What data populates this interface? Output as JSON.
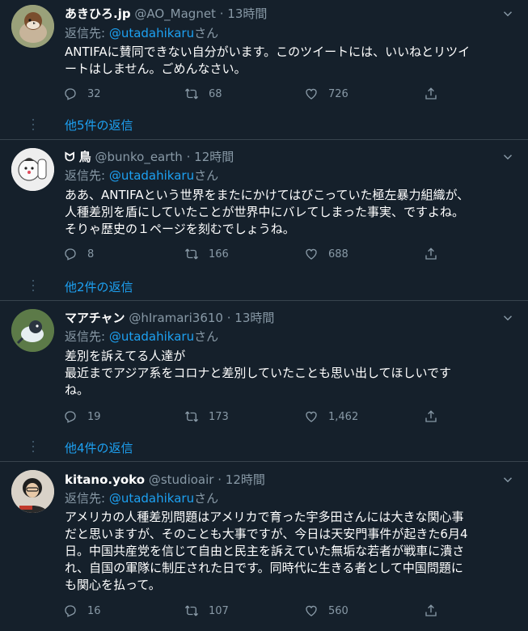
{
  "tweets": [
    {
      "name": "あきひろ.jp",
      "handle": "@AO_Magnet",
      "sep": "·",
      "time": "13時間",
      "reply_prefix": "返信先: ",
      "reply_to": "@utadahikaru",
      "reply_suffix": "さん",
      "text": "ANTIFAに賛同できない自分がいます。このツイートには、いいねとリツイ\nートはしません。ごめんなさい。",
      "replies": "32",
      "retweets": "68",
      "likes": "726",
      "more_replies": "他5件の返信"
    },
    {
      "name": "ᗢ 鳥",
      "handle": "@bunko_earth",
      "sep": "·",
      "time": "12時間",
      "reply_prefix": "返信先: ",
      "reply_to": "@utadahikaru",
      "reply_suffix": "さん",
      "text": "ああ、ANTIFAという世界をまたにかけてはびこっていた極左暴力組織が、\n人種差別を盾にしていたことが世界中にバレてしまった事実、ですよね。\nそりゃ歴史の１ページを刻むでしょうね。",
      "replies": "8",
      "retweets": "166",
      "likes": "688",
      "more_replies": "他2件の返信"
    },
    {
      "name": "マアチャン",
      "handle": "@hIramari3610",
      "sep": "·",
      "time": "13時間",
      "reply_prefix": "返信先: ",
      "reply_to": "@utadahikaru",
      "reply_suffix": "さん",
      "text": "差別を訴えてる人達が\n最近までアジア系をコロナと差別していたことも思い出してほしいです\nね。",
      "replies": "19",
      "retweets": "173",
      "likes": "1,462",
      "more_replies": "他4件の返信"
    },
    {
      "name": "kitano.yoko",
      "handle": "@studioair",
      "sep": "·",
      "time": "12時間",
      "reply_prefix": "返信先: ",
      "reply_to": "@utadahikaru",
      "reply_suffix": "さん",
      "text": "アメリカの人種差別問題はアメリカで育った宇多田さんには大きな関心事\nだと思いますが、そのことも大事ですが、今日は天安門事件が起きた6月4\n日。中国共産党を信じて自由と民主を訴えていた無垢な若者が戦車に潰さ\nれ、自国の軍隊に制圧された日です。同時代に生きる者として中国問題に\nも関心を払って。",
      "replies": "16",
      "retweets": "107",
      "likes": "560"
    }
  ],
  "colors": {
    "background": "#15202b",
    "muted": "#8899a6",
    "link": "#1da1f2",
    "separator": "#38444d"
  }
}
